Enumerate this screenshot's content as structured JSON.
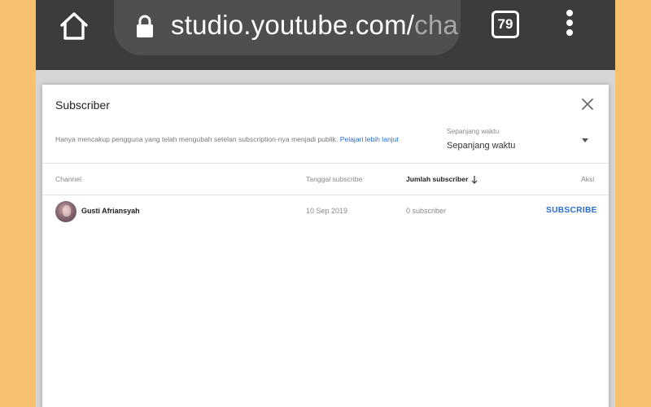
{
  "browser": {
    "url_main": "studio.youtube.com/",
    "url_faded": "cha",
    "tab_count": "79",
    "colors": {
      "bar": "#3c3c3c",
      "url_pill": "#4f4f4f"
    },
    "icons": [
      "home-icon",
      "lock-icon",
      "tabs-icon",
      "more-vert-icon"
    ]
  },
  "dialog": {
    "title": "Subscriber",
    "info_text": "Hanya mencakup pengguna yang telah mengubah setelan subscription-nya menjadi publik.",
    "info_link": "Pelajari lebih lanjut",
    "period": {
      "label": "Sepanjang waktu",
      "value": "Sepanjang waktu"
    },
    "table": {
      "headers": {
        "channel": "Channel",
        "date": "Tanggal subscribe",
        "count": "Jumlah subscriber",
        "action": "Aksi"
      },
      "rows": [
        {
          "name": "Gusti Afriansyah",
          "date": "10 Sep 2019",
          "count": "0 subscriber",
          "action": "SUBSCRIBE"
        }
      ]
    },
    "colors": {
      "link": "#2a6fd6"
    }
  }
}
